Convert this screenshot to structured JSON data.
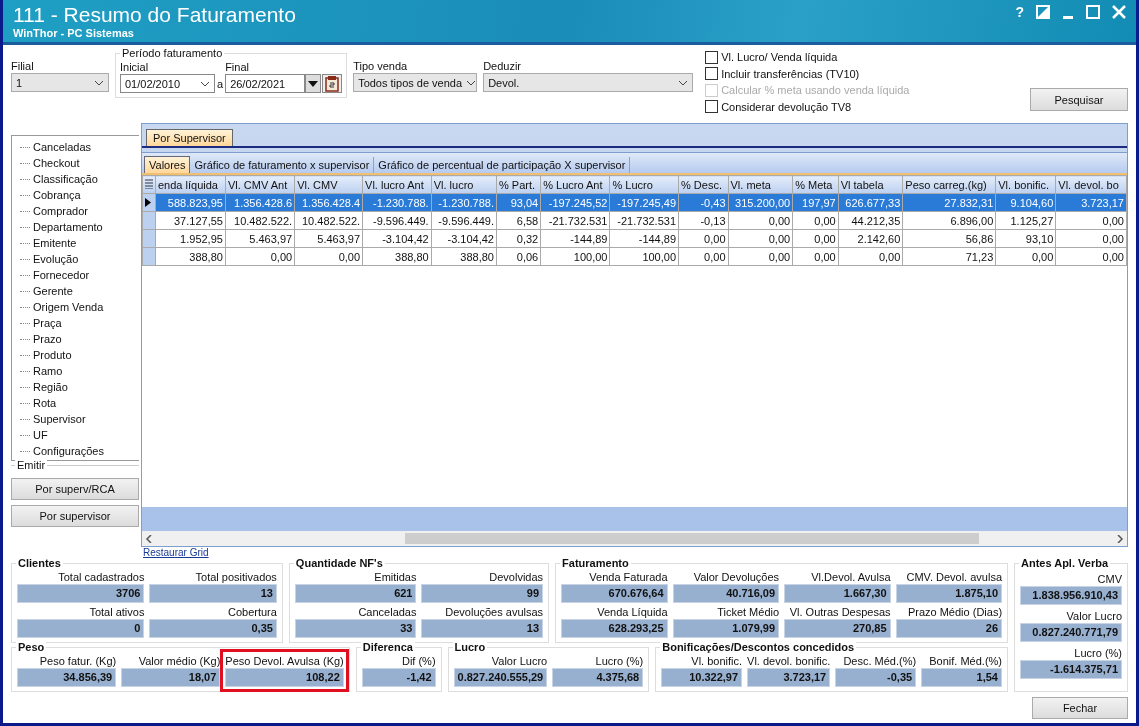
{
  "window": {
    "title": "111 - Resumo do Faturamento",
    "subtitle": "WinThor - PC Sistemas",
    "help_button": "?"
  },
  "filters": {
    "filial": {
      "label": "Filial",
      "value": "1"
    },
    "periodo": {
      "title": "Período faturamento",
      "inicial_label": "Inicial",
      "inicial": "01/02/2010",
      "separator": "a",
      "final_label": "Final",
      "final": "26/02/2021"
    },
    "tipo_venda": {
      "label": "Tipo venda",
      "value": "Todos tipos de venda"
    },
    "deduzir": {
      "label": "Deduzir",
      "value": "Devol."
    }
  },
  "options": [
    {
      "label": "Vl. Lucro/ Venda líquida",
      "checked": false,
      "disabled": false
    },
    {
      "label": "Incluir transferências  (TV10)",
      "checked": false,
      "disabled": false
    },
    {
      "label": "Calcular % meta usando venda líquida",
      "checked": false,
      "disabled": true
    },
    {
      "label": "Considerar devolução TV8",
      "checked": false,
      "disabled": false
    }
  ],
  "search_button": "Pesquisar",
  "sidebar": {
    "items": [
      {
        "label": "Canceladas",
        "selected": false
      },
      {
        "label": "Checkout",
        "selected": false
      },
      {
        "label": "Classificação",
        "selected": false
      },
      {
        "label": "Cobrança",
        "selected": false
      },
      {
        "label": "Comprador",
        "selected": false
      },
      {
        "label": "Departamento",
        "selected": false
      },
      {
        "label": "Emitente",
        "selected": false
      },
      {
        "label": "Evolução",
        "selected": false
      },
      {
        "label": "Fornecedor",
        "selected": false
      },
      {
        "label": "Gerente",
        "selected": false
      },
      {
        "label": "Origem Venda",
        "selected": false
      },
      {
        "label": "Praça",
        "selected": false
      },
      {
        "label": "Prazo",
        "selected": false
      },
      {
        "label": "Produto",
        "selected": false
      },
      {
        "label": "Ramo",
        "selected": false
      },
      {
        "label": "Região",
        "selected": false
      },
      {
        "label": "Rota",
        "selected": false
      },
      {
        "label": "Supervisor",
        "selected": false
      },
      {
        "label": "UF",
        "selected": false
      },
      {
        "label": "Configurações",
        "selected": false
      }
    ]
  },
  "emitir": {
    "title": "Emitir",
    "buttons": [
      "Por superv/RCA",
      "Por supervisor"
    ]
  },
  "tabs": [
    {
      "label": "Por Supervisor",
      "selected": true
    }
  ],
  "subtabs": [
    {
      "label": "Valores",
      "selected": true
    },
    {
      "label": "Gráfico de faturamento x supervisor",
      "selected": false
    },
    {
      "label": "Gráfico de percentual de participação X supervisor",
      "selected": false
    }
  ],
  "table": {
    "columns": [
      "enda líquida",
      "Vl. CMV Ant",
      "Vl. CMV",
      "Vl. lucro Ant",
      "Vl. lucro",
      "% Part.",
      "% Lucro Ant",
      "% Lucro",
      "% Desc.",
      "Vl. meta",
      "% Meta",
      "Vl tabela",
      "Peso carreg.(kg)",
      "Vl. bonific.",
      "Vl. devol. bo"
    ],
    "rows": [
      {
        "selected": true,
        "cells": [
          "588.823,95",
          "1.356.428.6",
          "1.356.428.4",
          "-1.230.788.",
          "-1.230.788.",
          "93,04",
          "-197.245,52",
          "-197.245,49",
          "-0,43",
          "315.200,00",
          "197,97",
          "626.677,33",
          "27.832,31",
          "9.104,60",
          "3.723,17"
        ]
      },
      {
        "selected": false,
        "cells": [
          "37.127,55",
          "10.482.522.",
          "10.482.522.",
          "-9.596.449.",
          "-9.596.449.",
          "6,58",
          "-21.732.531",
          "-21.732.531",
          "-0,13",
          "0,00",
          "0,00",
          "44.212,35",
          "6.896,00",
          "1.125,27",
          "0,00"
        ]
      },
      {
        "selected": false,
        "cells": [
          "1.952,95",
          "5.463,97",
          "5.463,97",
          "-3.104,42",
          "-3.104,42",
          "0,32",
          "-144,89",
          "-144,89",
          "0,00",
          "0,00",
          "0,00",
          "2.142,60",
          "56,86",
          "93,10",
          "0,00"
        ]
      },
      {
        "selected": false,
        "cells": [
          "388,80",
          "0,00",
          "0,00",
          "388,80",
          "388,80",
          "0,06",
          "100,00",
          "100,00",
          "0,00",
          "0,00",
          "0,00",
          "0,00",
          "71,23",
          "0,00",
          "0,00"
        ]
      }
    ]
  },
  "restore_link": "Restaurar Grid",
  "summary": {
    "rows": [
      [
        {
          "title": "Clientes",
          "rows": [
            [
              {
                "label": "Total cadastrados",
                "value": "3706"
              },
              {
                "label": "Total positivados",
                "value": "13"
              }
            ],
            [
              {
                "label": "Total ativos",
                "value": "0"
              },
              {
                "label": "Cobertura",
                "value": "0,35"
              }
            ]
          ]
        },
        {
          "title": "Quantidade NF's",
          "rows": [
            [
              {
                "label": "Emitidas",
                "value": "621"
              },
              {
                "label": "Devolvidas",
                "value": "99"
              }
            ],
            [
              {
                "label": "Canceladas",
                "value": "33"
              },
              {
                "label": "Devoluções avulsas",
                "value": "13"
              }
            ]
          ]
        },
        {
          "title": "Faturamento",
          "rows": [
            [
              {
                "label": "Venda Faturada",
                "value": "670.676,64"
              },
              {
                "label": "Valor Devoluções",
                "value": "40.716,09"
              },
              {
                "label": "Vl.Devol. Avulsa",
                "value": "1.667,30"
              },
              {
                "label": "CMV. Devol. avulsa",
                "value": "1.875,10"
              }
            ],
            [
              {
                "label": "Venda Líquida",
                "value": "628.293,25"
              },
              {
                "label": "Ticket Médio",
                "value": "1.079,99"
              },
              {
                "label": "Vl. Outras Despesas",
                "value": "270,85"
              },
              {
                "label": "Prazo Médio (Dias)",
                "value": "26"
              }
            ]
          ]
        }
      ],
      [
        {
          "title": "Peso",
          "rows": [
            [
              {
                "label": "Peso fatur. (Kg)",
                "value": "34.856,39"
              },
              {
                "label": "Valor médio (Kg)",
                "value": "18,07"
              },
              {
                "label": "Peso Devol. Avulsa (Kg)",
                "value": "108,22",
                "highlighted": true
              }
            ]
          ]
        },
        {
          "title": "Diferenca",
          "rows": [
            [
              {
                "label": "Dif (%)",
                "value": "-1,42"
              }
            ]
          ]
        },
        {
          "title": "Lucro",
          "rows": [
            [
              {
                "label": "Valor Lucro",
                "value": "0.827.240.555,29"
              },
              {
                "label": "Lucro (%)",
                "value": "4.375,68"
              }
            ]
          ]
        },
        {
          "title": "Bonificações/Descontos concedidos",
          "rows": [
            [
              {
                "label": "Vl. bonific.",
                "value": "10.322,97"
              },
              {
                "label": "Vl. devol. bonific.",
                "value": "3.723,17"
              },
              {
                "label": "Desc. Méd.(%)",
                "value": "-0,35"
              },
              {
                "label": "Bonif. Méd.(%)",
                "value": "1,54"
              }
            ]
          ]
        }
      ]
    ],
    "side": {
      "title": "Antes Apl. Verba",
      "rows": [
        [
          {
            "label": "CMV",
            "value": "1.838.956.910,43"
          }
        ],
        [
          {
            "label": "Valor Lucro",
            "value": "0.827.240.771,79"
          }
        ],
        [
          {
            "label": "Lucro (%)",
            "value": "-1.614.375,71"
          }
        ]
      ]
    }
  },
  "close_button": "Fechar"
}
